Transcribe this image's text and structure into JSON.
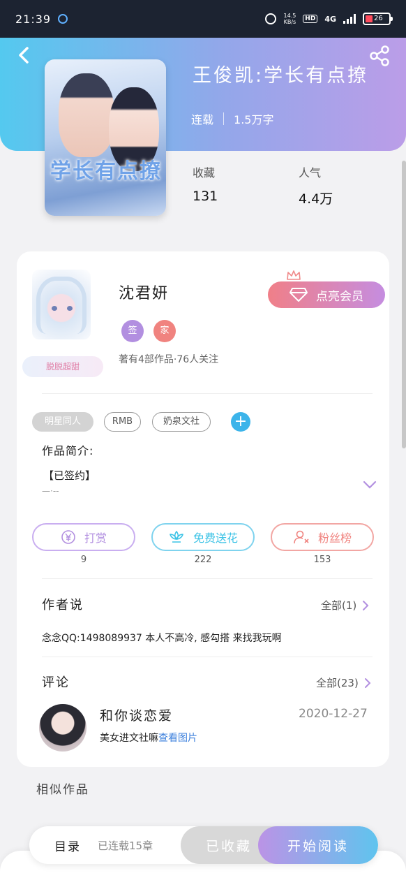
{
  "status_bar": {
    "time": "21:39",
    "net_speed_value": "14.5",
    "net_speed_unit": "KB/s",
    "hd": "HD",
    "network": "4G",
    "battery_level": "26"
  },
  "book": {
    "title": "王俊凯:学长有点撩",
    "status": "连载",
    "word_count": "1.5万字",
    "cover_title": "学长有点撩",
    "stats": [
      {
        "label": "收藏",
        "value": "131"
      },
      {
        "label": "人气",
        "value": "4.4万"
      }
    ]
  },
  "author": {
    "name": "沈君妍",
    "frame_badge": "脱脱超甜",
    "tags": [
      {
        "label": "签",
        "color": "#b28fe0"
      },
      {
        "label": "家",
        "color": "#f0837f"
      }
    ],
    "stats_text": "著有4部作品·76人关注",
    "vip_button": "点亮会员"
  },
  "book_tags": [
    "明星同人",
    "RMB",
    "奶泉文社"
  ],
  "intro": {
    "label": "作品简介:",
    "text": "【已签约】",
    "more": "—·--"
  },
  "actions": [
    {
      "label": "打赏",
      "count": "9",
      "color": "#b28fe0",
      "icon": "yuan-coin-icon"
    },
    {
      "label": "免费送花",
      "count": "222",
      "color": "#3cc3e6",
      "icon": "flower-icon"
    },
    {
      "label": "粉丝榜",
      "count": "153",
      "color": "#f0837f",
      "icon": "fans-icon"
    }
  ],
  "author_say": {
    "title": "作者说",
    "link": "全部(1)",
    "text": "念念QQ:1498089937 本人不高冷, 感勾搭 来找我玩啊"
  },
  "comments": {
    "title": "评论",
    "link": "全部(23)",
    "items": [
      {
        "user": "和你谈恋爱",
        "date": "2020-12-27",
        "text": "美女进文社嘛",
        "link_text": "查看图片"
      }
    ]
  },
  "similar": {
    "title": "相似作品"
  },
  "bottom_bar": {
    "toc_label": "目录",
    "toc_status": "已连载15章",
    "collected_label": "已收藏",
    "read_label": "开始阅读"
  }
}
